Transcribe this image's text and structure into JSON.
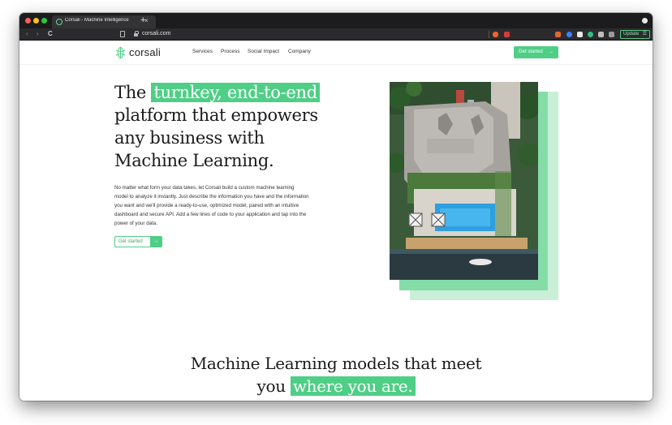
{
  "browser": {
    "tab_title": "Corsali - Machine Intelligence",
    "tab_close": "×",
    "new_tab": "+",
    "url": "corsali.com",
    "update_label": "Update",
    "update_menu": "☰",
    "back_icon": "‹",
    "forward_icon": "›",
    "reload_icon": "C"
  },
  "site": {
    "logo_text": "corsali",
    "nav": [
      "Services",
      "Process",
      "Social Impact",
      "Company"
    ],
    "header_cta": "Get started",
    "arrow": "→"
  },
  "hero": {
    "title_plain_1": "The",
    "title_highlight": "turnkey, end-to-end",
    "title_plain_2": "platform that empowers any business with Machine Learning.",
    "body": "No matter what form your data takes, let Corsali build a custom machine learning model to analyze it instantly. Just describe the information you have and the information you want and we'll provide a ready-to-use, optimized model, paired with an intuitive dashboard and secure API. Add a few lines of code to your application and tap into the power of your data.",
    "cta": "Get started"
  },
  "section": {
    "title_plain": "Machine Learning models that meet you",
    "title_highlight": "where you are."
  },
  "colors": {
    "brand_green": "#4fce86",
    "light_green": "#c9f0d7",
    "mid_green": "#85dca8",
    "browser_dark": "#1c1c1e"
  }
}
